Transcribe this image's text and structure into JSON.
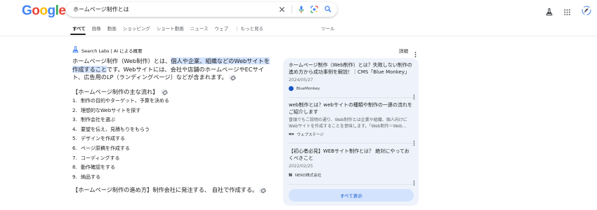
{
  "logo": {
    "letters": [
      "G",
      "o",
      "o",
      "g",
      "l",
      "e"
    ],
    "colors": [
      "#4285f4",
      "#ea4335",
      "#fbbc05",
      "#4285f4",
      "#34a853",
      "#ea4335"
    ]
  },
  "search": {
    "query": "ホームページ制作とは"
  },
  "tabs": [
    {
      "label": "すべて",
      "active": true
    },
    {
      "label": "画像"
    },
    {
      "label": "動画"
    },
    {
      "label": "ショッピング"
    },
    {
      "label": "ショート動画"
    },
    {
      "label": "ニュース"
    },
    {
      "label": "ウェブ"
    },
    {
      "label": "もっと見る"
    }
  ],
  "tools_label": "ツール",
  "ai_overview": {
    "header": "Search Labs | AI による概要",
    "detail_label": "詳細",
    "intro_before": "ホームページ制作（Web制作）とは、",
    "intro_highlight": "個人や企業、組織などのWebサイトを作成すること",
    "intro_after": "です。Webサイトには、会社や店舗のホームページやECサイト、広告用のLP（ランディングページ）などが含まれます。",
    "section_title": "【ホームページ制作の主な流れ】",
    "steps": [
      {
        "num": "1.",
        "text": "制作の目的やターゲット、予算を決める"
      },
      {
        "num": "2.",
        "text": "理想的なWebサイトを探す"
      },
      {
        "num": "3.",
        "text": "制作会社を選ぶ"
      },
      {
        "num": "4.",
        "text": "要望を伝え、見積もりをもらう"
      },
      {
        "num": "5.",
        "text": "デザインを作成する"
      },
      {
        "num": "6.",
        "text": "ページ原稿を作成する"
      },
      {
        "num": "7.",
        "text": "コーディングする"
      },
      {
        "num": "8.",
        "text": "動作確認をする"
      },
      {
        "num": "9.",
        "text": "納品する"
      }
    ],
    "howto": "【ホームページ制作の進め方】制作会社に発注する、 自社で作成する。"
  },
  "sources": {
    "items": [
      {
        "title": "ホームページ制作（Web制作）とは？失敗しない制作の進め方から成功事例を解説！｜CMS「Blue Monkey」",
        "date": "2024/05/27",
        "site": "BlueMonkey",
        "icon_color": "#1a56c4"
      },
      {
        "title": "web制作とは？webサイトの種類や制作の一連の流れをご紹介します",
        "snippet": "冒頭でもご説明の通り、Web制作とは企業や組織、個人向けにWebサイトを作成することを意味します。「Web制作＝Web...",
        "site": "ウェブステージ",
        "icon_color": "#3c4043"
      },
      {
        "title": "【初心者必見】WEBサイト制作とは？ 絶対にやっておくべきこと",
        "date": "2022/02/25",
        "site": "NERD株式会社",
        "icon_color": "#202124"
      }
    ],
    "show_all": "すべて表示"
  }
}
